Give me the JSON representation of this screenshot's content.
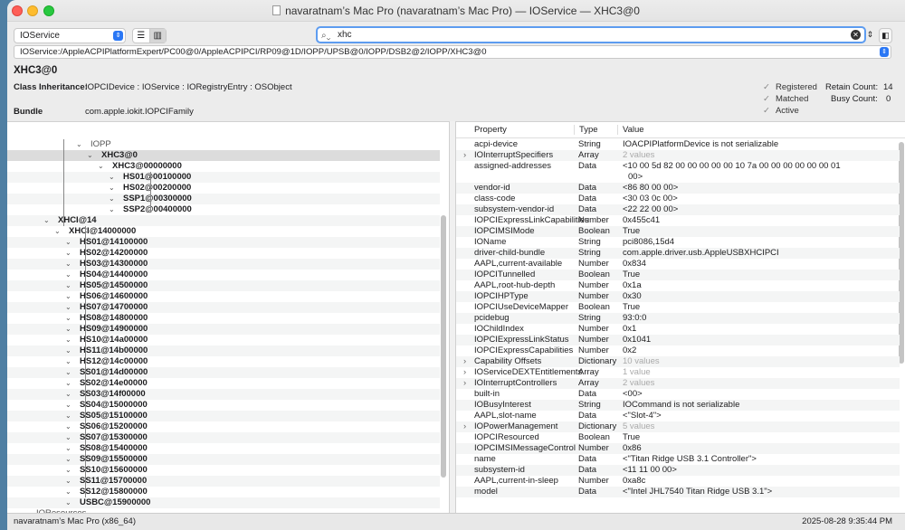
{
  "window": {
    "title": "navaratnam’s Mac Pro (navaratnam’s Mac Pro) — IOService — XHC3@0"
  },
  "toolbar": {
    "plane": "IOService",
    "search_value": "xhc"
  },
  "path": "IOService:/AppleACPIPlatformExpert/PC00@0/AppleACPIPCI/RP09@1D/IOPP/UPSB@0/IOPP/DSB2@2/IOPP/XHC3@0",
  "info": {
    "name": "XHC3@0",
    "class_label": "Class Inheritance:",
    "class_value": "IOPCIDevice : IOService : IORegistryEntry : OSObject",
    "bundle_label": "Bundle",
    "bundle_value": "com.apple.iokit.IOPCIFamily",
    "registered": "Registered",
    "matched": "Matched",
    "active": "Active",
    "retain_label": "Retain Count:",
    "retain_value": "14",
    "busy_label": "Busy Count:",
    "busy_value": "0"
  },
  "tree": [
    {
      "label": "IOPP",
      "indent": 6,
      "light": true
    },
    {
      "label": "XHC3@0",
      "indent": 7,
      "selected": true
    },
    {
      "label": "XHC3@00000000",
      "indent": 8
    },
    {
      "label": "HS01@00100000",
      "indent": 9
    },
    {
      "label": "HS02@00200000",
      "indent": 9
    },
    {
      "label": "SSP1@00300000",
      "indent": 9
    },
    {
      "label": "SSP2@00400000",
      "indent": 9
    },
    {
      "label": "XHCI@14",
      "indent": 3
    },
    {
      "label": "XHCI@14000000",
      "indent": 4
    },
    {
      "label": "HS01@14100000",
      "indent": 5
    },
    {
      "label": "HS02@14200000",
      "indent": 5
    },
    {
      "label": "HS03@14300000",
      "indent": 5
    },
    {
      "label": "HS04@14400000",
      "indent": 5
    },
    {
      "label": "HS05@14500000",
      "indent": 5
    },
    {
      "label": "HS06@14600000",
      "indent": 5
    },
    {
      "label": "HS07@14700000",
      "indent": 5
    },
    {
      "label": "HS08@14800000",
      "indent": 5
    },
    {
      "label": "HS09@14900000",
      "indent": 5
    },
    {
      "label": "HS10@14a00000",
      "indent": 5
    },
    {
      "label": "HS11@14b00000",
      "indent": 5
    },
    {
      "label": "HS12@14c00000",
      "indent": 5
    },
    {
      "label": "SS01@14d00000",
      "indent": 5
    },
    {
      "label": "SS02@14e00000",
      "indent": 5
    },
    {
      "label": "SS03@14f00000",
      "indent": 5
    },
    {
      "label": "SS04@15000000",
      "indent": 5
    },
    {
      "label": "SS05@15100000",
      "indent": 5
    },
    {
      "label": "SS06@15200000",
      "indent": 5
    },
    {
      "label": "SS07@15300000",
      "indent": 5
    },
    {
      "label": "SS08@15400000",
      "indent": 5
    },
    {
      "label": "SS09@15500000",
      "indent": 5
    },
    {
      "label": "SS10@15600000",
      "indent": 5
    },
    {
      "label": "SS11@15700000",
      "indent": 5
    },
    {
      "label": "SS12@15800000",
      "indent": 5
    },
    {
      "label": "USBC@15900000",
      "indent": 5
    },
    {
      "label": "IOResources",
      "indent": 1,
      "light": true
    }
  ],
  "table": {
    "headers": [
      "Property",
      "Type",
      "Value"
    ],
    "rows": [
      {
        "p": "acpi-device",
        "t": "String",
        "v": "IOACPIPlatformDevice is not serializable"
      },
      {
        "p": "IOInterruptSpecifiers",
        "t": "Array",
        "v": "2 values",
        "exp": true,
        "gray": true
      },
      {
        "p": "assigned-addresses",
        "t": "Data",
        "v": "<10 00 5d 82 00 00 00 00 00 10 7a 00 00 00 00 00 00 01",
        "v2": "00>"
      },
      {
        "p": "vendor-id",
        "t": "Data",
        "v": "<86 80 00 00>"
      },
      {
        "p": "class-code",
        "t": "Data",
        "v": "<30 03 0c 00>"
      },
      {
        "p": "subsystem-vendor-id",
        "t": "Data",
        "v": "<22 22 00 00>"
      },
      {
        "p": "IOPCIExpressLinkCapabilities",
        "t": "Number",
        "v": "0x455c41"
      },
      {
        "p": "IOPCIMSIMode",
        "t": "Boolean",
        "v": "True"
      },
      {
        "p": "IOName",
        "t": "String",
        "v": "pci8086,15d4"
      },
      {
        "p": "driver-child-bundle",
        "t": "String",
        "v": "com.apple.driver.usb.AppleUSBXHCIPCI"
      },
      {
        "p": "AAPL,current-available",
        "t": "Number",
        "v": "0x834"
      },
      {
        "p": "IOPCITunnelled",
        "t": "Boolean",
        "v": "True"
      },
      {
        "p": "AAPL,root-hub-depth",
        "t": "Number",
        "v": "0x1a"
      },
      {
        "p": "IOPCIHPType",
        "t": "Number",
        "v": "0x30"
      },
      {
        "p": "IOPCIUseDeviceMapper",
        "t": "Boolean",
        "v": "True"
      },
      {
        "p": "pcidebug",
        "t": "String",
        "v": "93:0:0"
      },
      {
        "p": "IOChildIndex",
        "t": "Number",
        "v": "0x1"
      },
      {
        "p": "IOPCIExpressLinkStatus",
        "t": "Number",
        "v": "0x1041"
      },
      {
        "p": "IOPCIExpressCapabilities",
        "t": "Number",
        "v": "0x2"
      },
      {
        "p": "Capability Offsets",
        "t": "Dictionary",
        "v": "10 values",
        "exp": true,
        "gray": true
      },
      {
        "p": "IOServiceDEXTEntitlements",
        "t": "Array",
        "v": "1 value",
        "exp": true,
        "gray": true
      },
      {
        "p": "IOInterruptControllers",
        "t": "Array",
        "v": "2 values",
        "exp": true,
        "gray": true
      },
      {
        "p": "built-in",
        "t": "Data",
        "v": "<00>"
      },
      {
        "p": "IOBusyInterest",
        "t": "String",
        "v": "IOCommand is not serializable"
      },
      {
        "p": "AAPL,slot-name",
        "t": "Data",
        "v": "<\"Slot-4\">"
      },
      {
        "p": "IOPowerManagement",
        "t": "Dictionary",
        "v": "5 values",
        "exp": true,
        "gray": true
      },
      {
        "p": "IOPCIResourced",
        "t": "Boolean",
        "v": "True"
      },
      {
        "p": "IOPCIMSIMessageControl",
        "t": "Number",
        "v": "0x86"
      },
      {
        "p": "name",
        "t": "Data",
        "v": "<\"Titan Ridge USB 3.1 Controller\">"
      },
      {
        "p": "subsystem-id",
        "t": "Data",
        "v": "<11 11 00 00>"
      },
      {
        "p": "AAPL,current-in-sleep",
        "t": "Number",
        "v": "0xa8c"
      },
      {
        "p": "model",
        "t": "Data",
        "v": "<\"Intel JHL7540 Titan Ridge USB 3.1\">"
      }
    ]
  },
  "status": {
    "left": "navaratnam’s Mac Pro (x86_64)",
    "right": "2025-08-28 9:35:44 PM"
  }
}
